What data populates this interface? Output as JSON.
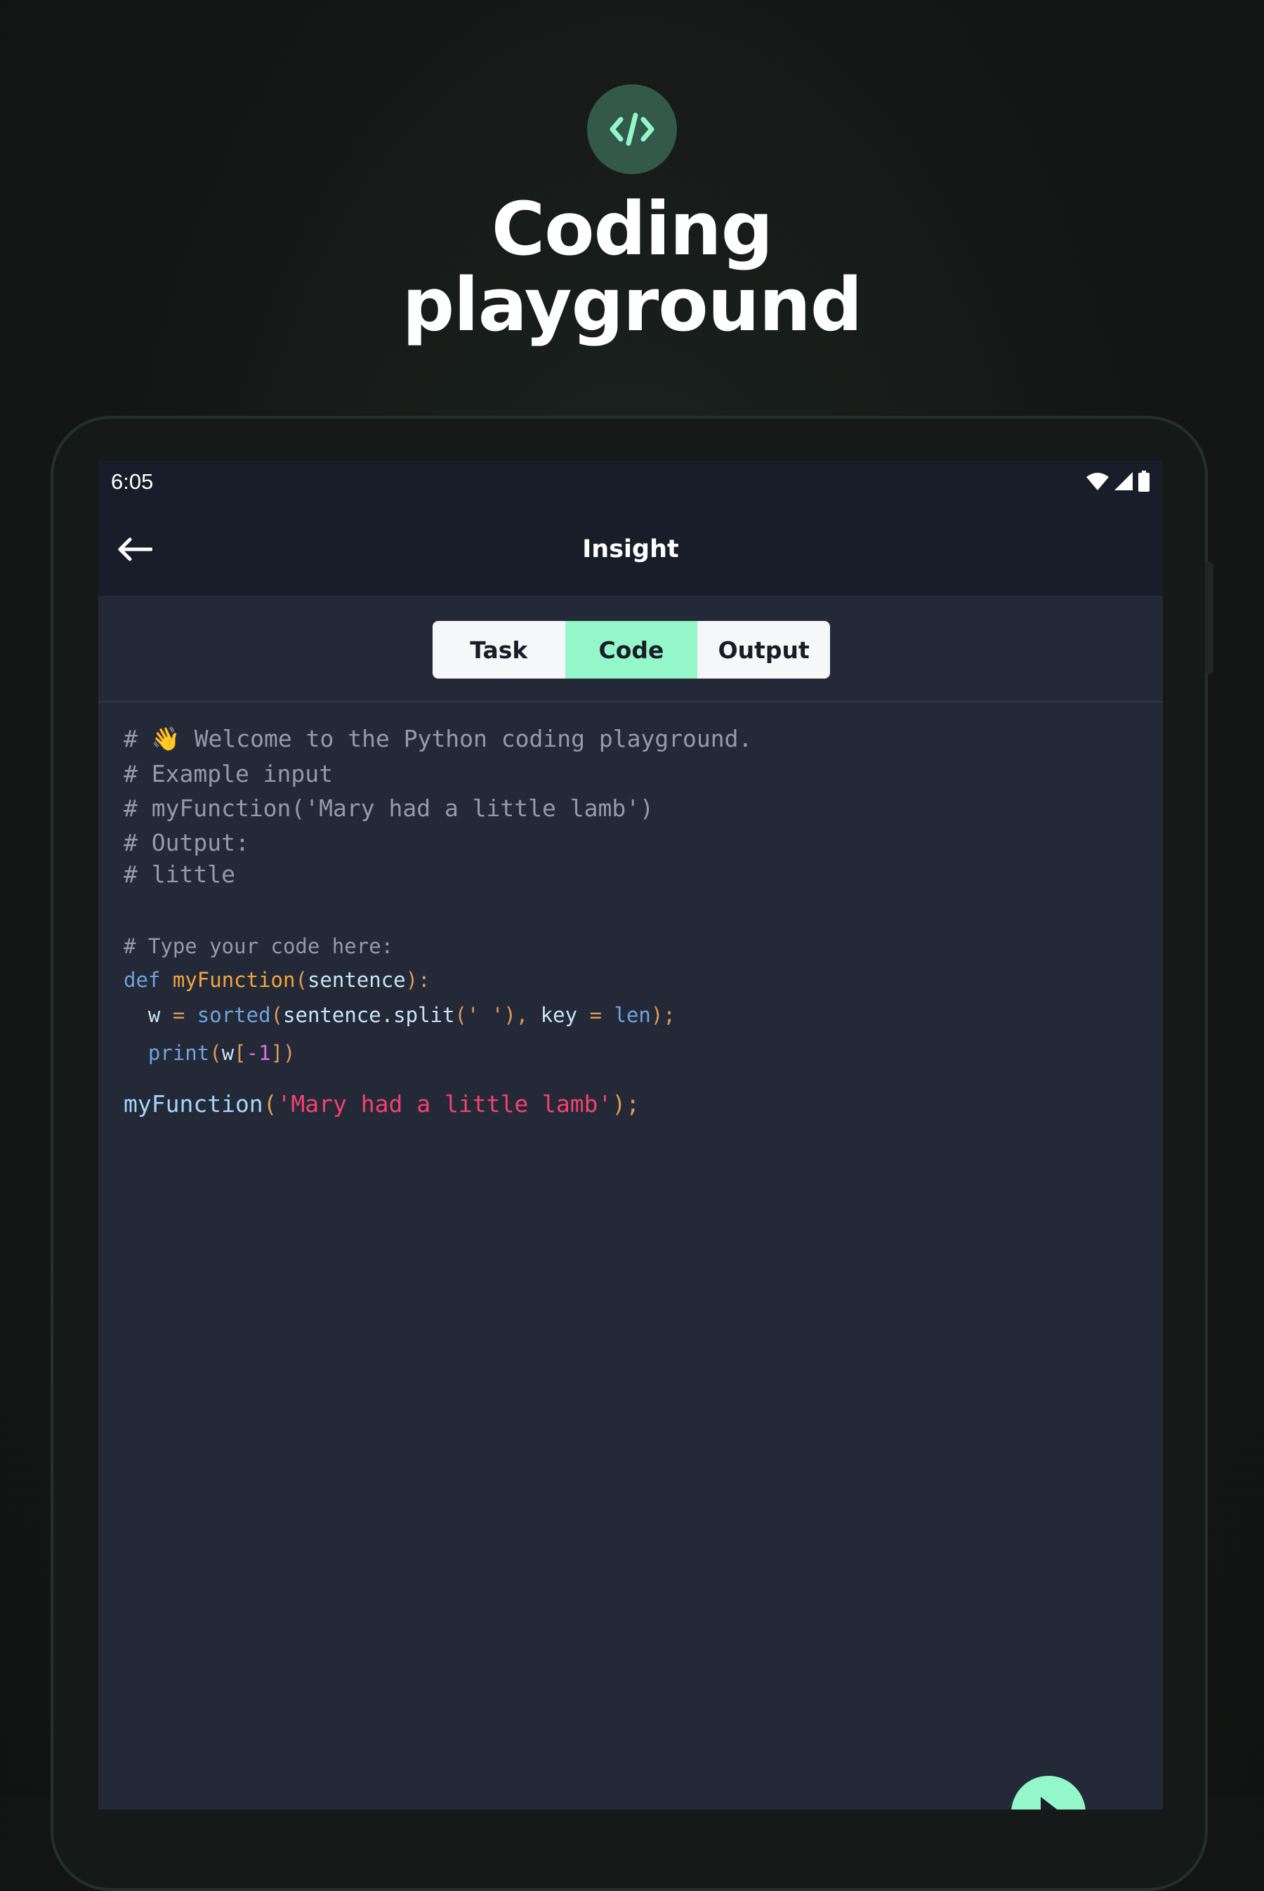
{
  "hero": {
    "icon": "code-icon",
    "title_line1": "Coding",
    "title_line2": "playground"
  },
  "status_bar": {
    "time": "6:05",
    "icons": [
      "wifi-icon",
      "signal-icon",
      "battery-icon"
    ]
  },
  "app_bar": {
    "back_icon": "arrow-left-icon",
    "title": "Insight"
  },
  "tabs": [
    {
      "label": "Task",
      "active": false
    },
    {
      "label": "Code",
      "active": true
    },
    {
      "label": "Output",
      "active": false
    }
  ],
  "code": {
    "comment_lines": [
      "# 👋 Welcome to the Python coding playground.",
      "# Example input",
      "# myFunction('Mary had a little lamb')",
      "# Output:",
      "# little"
    ],
    "type_comment": "# Type your code here:",
    "def_line": {
      "kw": "def",
      "name": "myFunction",
      "open": "(",
      "param": "sentence",
      "close": "):"
    },
    "assign_line": {
      "var": "w",
      "eq": "=",
      "fn": "sorted",
      "open": "(",
      "obj": "sentence.split",
      "open2": "(",
      "str": "' '",
      "close2": "),",
      "key": "key",
      "eq2": "=",
      "len": "len",
      "close": ");"
    },
    "print_line": {
      "fn": "print",
      "open": "(",
      "var": "w",
      "ob": "[",
      "num": "-1",
      "cb": "]",
      "close": ")"
    },
    "call_line": {
      "name": "myFunction",
      "open": "(",
      "str": "'Mary had a little lamb'",
      "close": ");"
    }
  },
  "colors": {
    "accent": "#94f7c9",
    "screen_bg": "#232937",
    "appbar_bg": "#181d29"
  },
  "fab": {
    "icon": "play-icon"
  }
}
